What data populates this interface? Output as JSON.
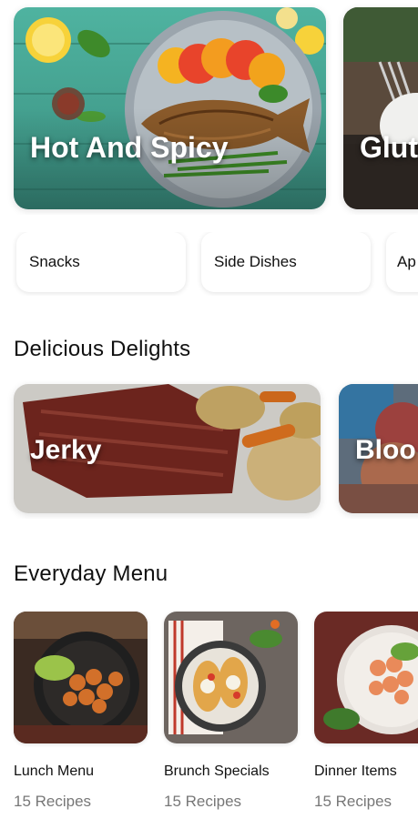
{
  "featured": [
    {
      "title": "Hot And Spicy"
    },
    {
      "title": "Glut"
    }
  ],
  "categories": [
    {
      "label": "Snacks"
    },
    {
      "label": "Side Dishes"
    },
    {
      "label": "Ap"
    }
  ],
  "sections": {
    "delights_title": "Delicious Delights",
    "everyday_title": "Everyday Menu"
  },
  "delights": [
    {
      "title": "Jerky"
    },
    {
      "title": "Bloo"
    }
  ],
  "everyday": [
    {
      "name": "Lunch Menu",
      "count": "15 Recipes"
    },
    {
      "name": "Brunch Specials",
      "count": "15 Recipes"
    },
    {
      "name": "Dinner Items",
      "count": "15 Recipes"
    }
  ]
}
